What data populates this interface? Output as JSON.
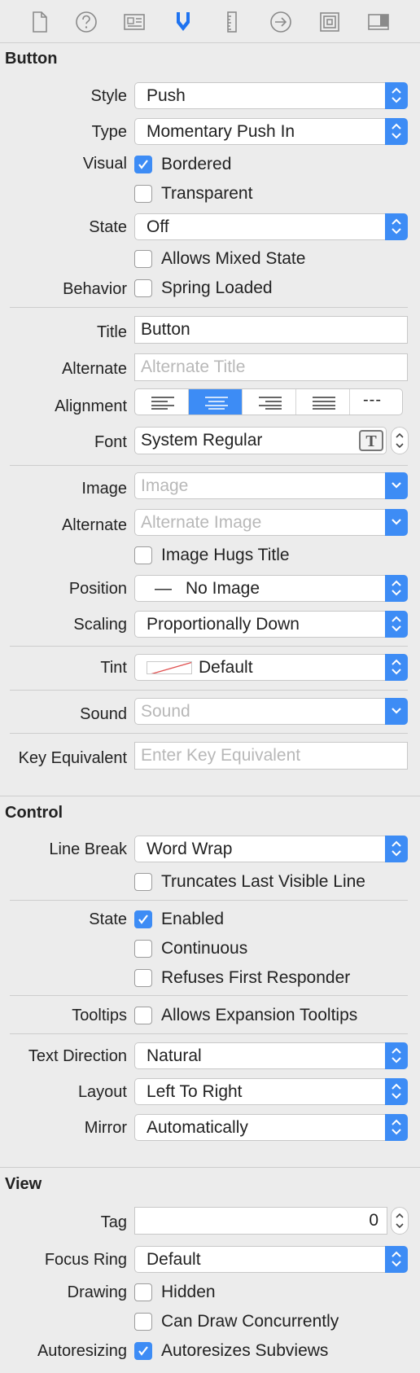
{
  "toolbar": {
    "tabs": [
      {
        "icon": "file-icon",
        "active": false
      },
      {
        "icon": "help-icon",
        "active": false
      },
      {
        "icon": "identity-icon",
        "active": false
      },
      {
        "icon": "attributes-icon",
        "active": true
      },
      {
        "icon": "ruler-icon",
        "active": false
      },
      {
        "icon": "connections-icon",
        "active": false
      },
      {
        "icon": "bindings-icon",
        "active": false
      },
      {
        "icon": "effects-icon",
        "active": false
      }
    ]
  },
  "button_section": {
    "title": "Button",
    "style": {
      "label": "Style",
      "value": "Push"
    },
    "type": {
      "label": "Type",
      "value": "Momentary Push In"
    },
    "visual": {
      "label": "Visual",
      "bordered": "Bordered",
      "bordered_checked": true,
      "transparent": "Transparent",
      "transparent_checked": false
    },
    "state": {
      "label": "State",
      "value": "Off"
    },
    "allows_mixed": {
      "label": "Allows Mixed State",
      "checked": false
    },
    "behavior": {
      "label": "Behavior",
      "spring": "Spring Loaded",
      "checked": false
    },
    "title_field": {
      "label": "Title",
      "value": "Button"
    },
    "alternate": {
      "label": "Alternate",
      "placeholder": "Alternate Title"
    },
    "alignment": {
      "label": "Alignment",
      "options": [
        "left",
        "center",
        "right",
        "justified",
        "natural"
      ],
      "selected": "center",
      "natural_glyph": "---"
    },
    "font": {
      "label": "Font",
      "value": "System Regular",
      "icon": "font-icon"
    },
    "image": {
      "label": "Image",
      "placeholder": "Image"
    },
    "alt_image": {
      "label": "Alternate",
      "placeholder": "Alternate Image"
    },
    "hugs": {
      "label": "Image Hugs Title",
      "checked": false
    },
    "position": {
      "label": "Position",
      "dash": "—",
      "value": "No Image"
    },
    "scaling": {
      "label": "Scaling",
      "value": "Proportionally Down"
    },
    "tint": {
      "label": "Tint",
      "value": "Default"
    },
    "sound": {
      "label": "Sound",
      "placeholder": "Sound"
    },
    "key": {
      "label": "Key Equivalent",
      "placeholder": "Enter Key Equivalent"
    }
  },
  "control_section": {
    "title": "Control",
    "line_break": {
      "label": "Line Break",
      "value": "Word Wrap"
    },
    "truncates": {
      "label": "Truncates Last Visible Line",
      "checked": false
    },
    "state": {
      "label": "State",
      "enabled": "Enabled",
      "enabled_checked": true,
      "continuous": "Continuous",
      "continuous_checked": false,
      "refuses": "Refuses First Responder",
      "refuses_checked": false
    },
    "tooltips": {
      "label": "Tooltips",
      "value": "Allows Expansion Tooltips",
      "checked": false
    },
    "text_direction": {
      "label": "Text Direction",
      "value": "Natural"
    },
    "layout": {
      "label": "Layout",
      "value": "Left To Right"
    },
    "mirror": {
      "label": "Mirror",
      "value": "Automatically"
    }
  },
  "view_section": {
    "title": "View",
    "tag": {
      "label": "Tag",
      "value": "0"
    },
    "focus_ring": {
      "label": "Focus Ring",
      "value": "Default"
    },
    "drawing": {
      "label": "Drawing",
      "hidden": "Hidden",
      "hidden_checked": false,
      "concurrent": "Can Draw Concurrently",
      "concurrent_checked": false
    },
    "autoresizing": {
      "label": "Autoresizing",
      "value": "Autoresizes Subviews",
      "checked": true
    }
  },
  "colors": {
    "accent": "#3d8cf5",
    "background": "#ececec",
    "tint_swatch_line": "#e05050"
  }
}
